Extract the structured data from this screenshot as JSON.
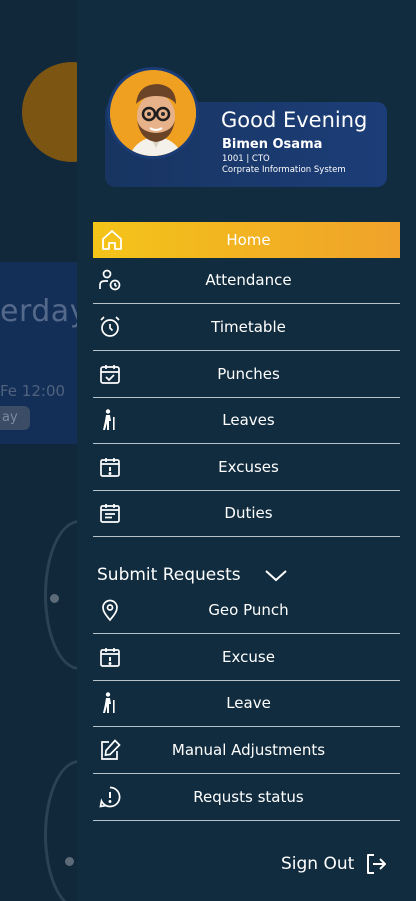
{
  "background": {
    "card_title": "erday",
    "card_sub": "Fe 12:00",
    "card_pill": "ay"
  },
  "profile": {
    "greeting": "Good Evening",
    "name": "Bimen Osama",
    "id_role": "1001 | CTO",
    "organization": "Corprate Information System"
  },
  "menu": {
    "items": [
      {
        "label": "Home",
        "icon": "home-icon",
        "active": true
      },
      {
        "label": "Attendance",
        "icon": "user-clock-icon"
      },
      {
        "label": "Timetable",
        "icon": "alarm-clock-icon"
      },
      {
        "label": "Punches",
        "icon": "calendar-check-icon"
      },
      {
        "label": "Leaves",
        "icon": "walking-person-icon"
      },
      {
        "label": "Excuses",
        "icon": "calendar-exclamation-icon"
      },
      {
        "label": "Duties",
        "icon": "calendar-list-icon"
      }
    ]
  },
  "submit_requests": {
    "title": "Submit Requests",
    "items": [
      {
        "label": "Geo Punch",
        "icon": "location-pin-icon"
      },
      {
        "label": "Excuse",
        "icon": "calendar-exclamation-icon"
      },
      {
        "label": "Leave",
        "icon": "walking-person-icon"
      },
      {
        "label": "Manual Adjustments",
        "icon": "edit-icon"
      },
      {
        "label": "Requsts status",
        "icon": "info-bubble-icon"
      }
    ]
  },
  "sign_out": {
    "label": "Sign Out"
  },
  "colors": {
    "drawer_bg": "#112c3e",
    "active_gradient_start": "#f4c419",
    "active_gradient_end": "#f0a22a",
    "profile_card": "#1c3d78"
  }
}
